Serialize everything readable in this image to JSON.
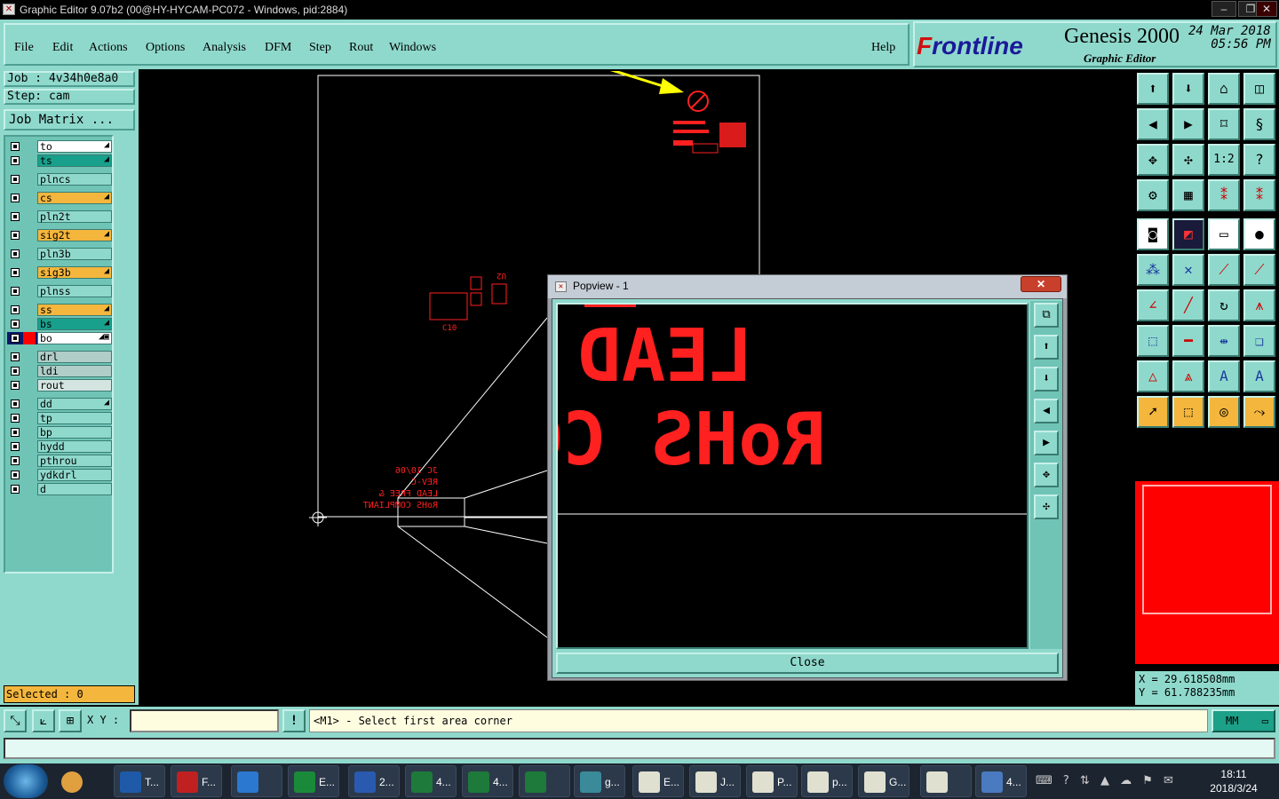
{
  "window": {
    "title": "Graphic Editor 9.07b2 (00@HY-HYCAM-PC072 - Windows, pid:2884)",
    "controls": [
      "–",
      "❐",
      "✕"
    ]
  },
  "menu": {
    "items": [
      "File",
      "Edit",
      "Actions",
      "Options",
      "Analysis",
      "DFM",
      "Step",
      "Rout",
      "Windows"
    ],
    "help": "Help"
  },
  "brand": {
    "logo": "Frontline",
    "product": "Genesis 2000",
    "subtitle": "Graphic Editor",
    "date": "24 Mar 2018",
    "time": "05:56 PM"
  },
  "job": {
    "job_line": "Job : 4v34h0e8a0",
    "step_line": "Step: cam",
    "matrix_button": "Job Matrix ..."
  },
  "layers": [
    {
      "name": "to",
      "style": "white",
      "arrow": "◢"
    },
    {
      "name": "ts",
      "style": "teal",
      "arrow": "◢"
    },
    {
      "name": "plncs",
      "style": "plain",
      "arrow": ""
    },
    {
      "name": "cs",
      "style": "orange",
      "arrow": "◢"
    },
    {
      "name": "pln2t",
      "style": "plain",
      "arrow": ""
    },
    {
      "name": "sig2t",
      "style": "orange",
      "arrow": "◢"
    },
    {
      "name": "pln3b",
      "style": "plain",
      "arrow": ""
    },
    {
      "name": "sig3b",
      "style": "orange",
      "arrow": "◢"
    },
    {
      "name": "plnss",
      "style": "plain",
      "arrow": ""
    },
    {
      "name": "ss",
      "style": "orange",
      "arrow": "◢"
    },
    {
      "name": "bs",
      "style": "teal",
      "arrow": "◢"
    },
    {
      "name": "bo",
      "style": "white",
      "arrow": "◢▣"
    },
    {
      "name": "drl",
      "style": "grey",
      "arrow": ""
    },
    {
      "name": "ldi",
      "style": "grey",
      "arrow": ""
    },
    {
      "name": "rout",
      "style": "lgrey",
      "arrow": ""
    },
    {
      "name": "dd",
      "style": "plain",
      "arrow": "◢"
    },
    {
      "name": "tp",
      "style": "plain",
      "arrow": ""
    },
    {
      "name": "bp",
      "style": "plain",
      "arrow": ""
    },
    {
      "name": "hydd",
      "style": "plain",
      "arrow": ""
    },
    {
      "name": "pthrou",
      "style": "plain",
      "arrow": ""
    },
    {
      "name": "ydkdrl",
      "style": "plain",
      "arrow": ""
    },
    {
      "name": "d",
      "style": "plain",
      "arrow": ""
    }
  ],
  "selected": "Selected : 0",
  "canvas": {
    "board_text": [
      "JC 10/06",
      "REV-C",
      "LEAD FREE &",
      "RoHS COMPLIANT"
    ],
    "component_labels": [
      "C10",
      "U2"
    ]
  },
  "popview": {
    "title": "Popview - 1",
    "close_x": "✕",
    "text_line1": "LEAD",
    "text_line2": "RoHS CO",
    "close_button": "Close"
  },
  "coords": {
    "x": "X =  29.618508mm",
    "y": "Y =  61.788235mm"
  },
  "status": {
    "xy_label": "X Y :",
    "xy_value": "",
    "alert": "!",
    "prompt": "<M1> - Select first area corner",
    "units": "MM"
  },
  "taskbar": {
    "items": [
      {
        "label": "T...",
        "color": "#1f5aa8"
      },
      {
        "label": "F...",
        "color": "#c02020"
      },
      {
        "label": "",
        "color": "#2a78d0"
      },
      {
        "label": "E...",
        "color": "#1a8a3a"
      },
      {
        "label": "2...",
        "color": "#2a5ab0"
      },
      {
        "label": "4...",
        "color": "#1d7a3a"
      },
      {
        "label": "4...",
        "color": "#1d7a3a"
      },
      {
        "label": "",
        "color": "#1d7a3a"
      },
      {
        "label": "g...",
        "color": "#3a8a9a"
      },
      {
        "label": "E...",
        "color": "#e0e0d0"
      },
      {
        "label": "J...",
        "color": "#e0e0d0"
      },
      {
        "label": "P...",
        "color": "#e0e0d0"
      },
      {
        "label": "p...",
        "color": "#e0e0d0"
      },
      {
        "label": "G...",
        "color": "#e0e0d0"
      },
      {
        "label": "",
        "color": "#e0e0d0"
      },
      {
        "label": "4...",
        "color": "#4a7ac0"
      }
    ],
    "tray": "⌨ ? ⇅ ▲ ☁ ⚑ ✉",
    "time": "18:11",
    "date": "2018/3/24"
  },
  "colors": {
    "panel": "#8fd9cc",
    "highlight_orange": "#f4b63c",
    "layer_red": "#ff0000",
    "annotation_arrow": "#ffff00"
  }
}
